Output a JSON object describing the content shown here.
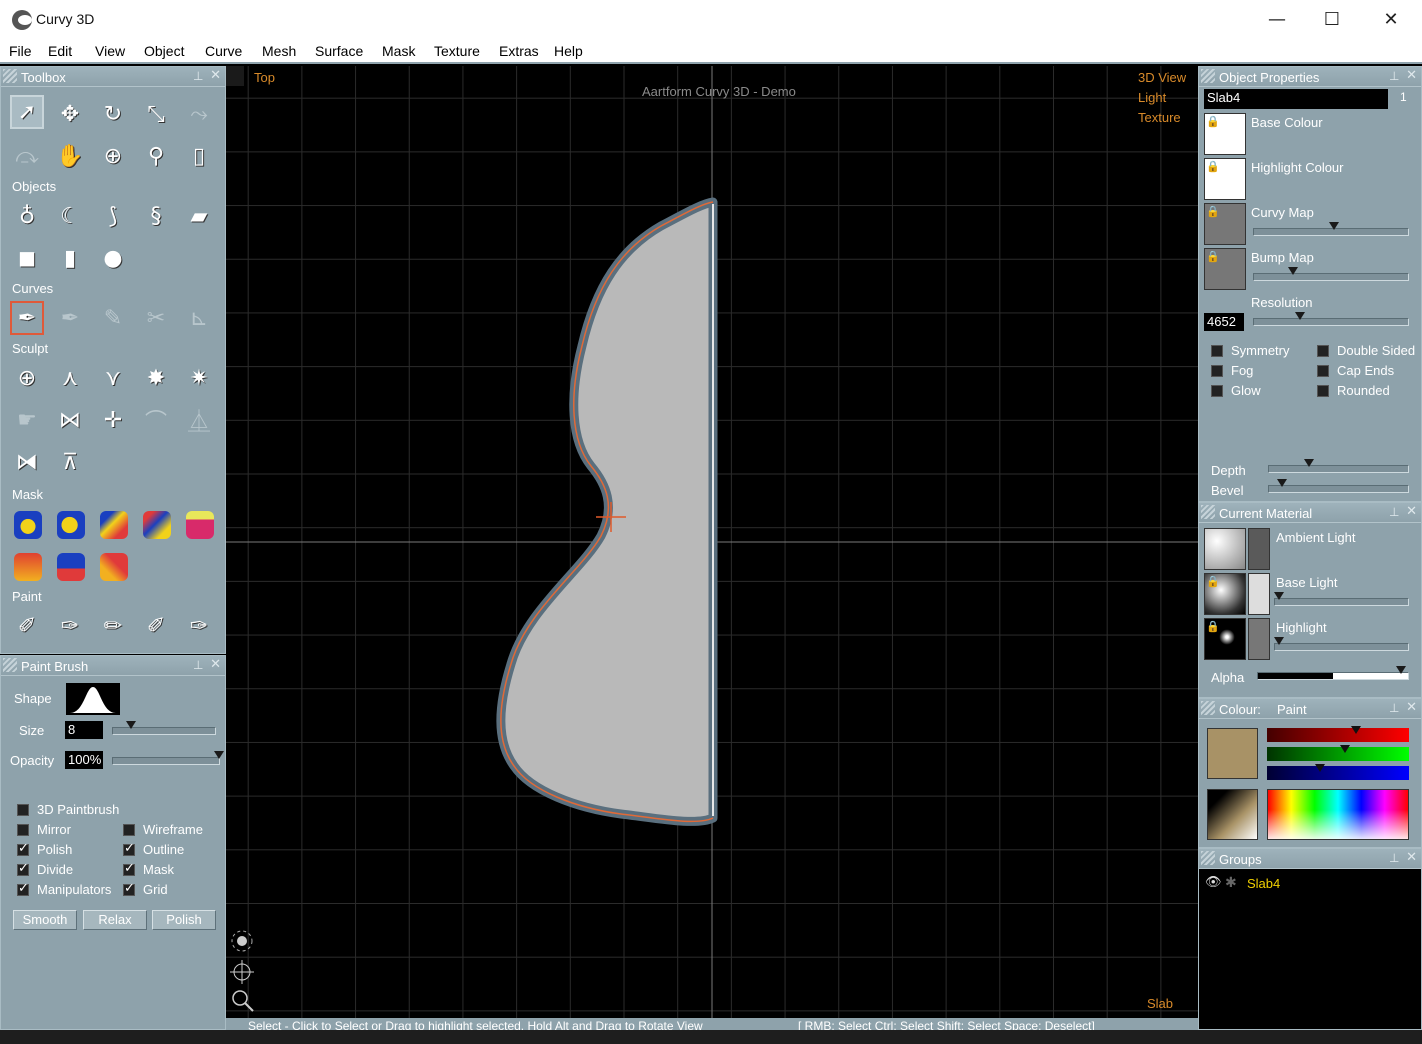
{
  "window": {
    "title": "Curvy 3D",
    "minimize": "—",
    "maximize": "☐",
    "close": "✕"
  },
  "menu": [
    "File",
    "Edit",
    "View",
    "Object",
    "Curve",
    "Mesh",
    "Surface",
    "Mask",
    "Texture",
    "Extras",
    "Help"
  ],
  "toolbox": {
    "title": "Toolbox",
    "sections": {
      "objects": "Objects",
      "curves": "Curves",
      "sculpt": "Sculpt",
      "mask": "Mask",
      "paint": "Paint"
    }
  },
  "paint_brush": {
    "title": "Paint Brush",
    "shape_label": "Shape",
    "size_label": "Size",
    "size_value": "8",
    "size_level": 0.18,
    "opacity_label": "Opacity",
    "opacity_value": "100%",
    "opacity_level": 1.0,
    "options": [
      {
        "label": "3D Paintbrush",
        "checked": false
      },
      {
        "label": "Mirror",
        "checked": false
      },
      {
        "label": "Wireframe",
        "checked": false
      },
      {
        "label": "Polish",
        "checked": true
      },
      {
        "label": "Outline",
        "checked": true
      },
      {
        "label": "Divide",
        "checked": true
      },
      {
        "label": "Mask",
        "checked": true
      },
      {
        "label": "Manipulators",
        "checked": true
      },
      {
        "label": "Grid",
        "checked": true
      }
    ],
    "buttons": [
      "Smooth",
      "Relax",
      "Polish"
    ]
  },
  "viewport": {
    "view_name": "Top",
    "watermark": "Aartform Curvy 3D - Demo",
    "modes": [
      "3D View",
      "Light",
      "Texture"
    ],
    "object_type": "Slab"
  },
  "object_properties": {
    "title": "Object Properties",
    "name": "Slab4",
    "index": "1",
    "base_colour": "Base Colour",
    "highlight_colour": "Highlight Colour",
    "curvy_map": "Curvy Map",
    "curvy_map_level": 0.52,
    "bump_map": "Bump Map",
    "bump_map_level": 0.25,
    "resolution_label": "Resolution",
    "resolution_value": "4652",
    "resolution_level": 0.3,
    "flags": [
      {
        "label": "Symmetry",
        "checked": false
      },
      {
        "label": "Double Sided",
        "checked": false
      },
      {
        "label": "Fog",
        "checked": false
      },
      {
        "label": "Cap Ends",
        "checked": false
      },
      {
        "label": "Glow",
        "checked": false
      },
      {
        "label": "Rounded",
        "checked": false
      }
    ],
    "depth_label": "Depth",
    "depth_level": 0.29,
    "bevel_label": "Bevel",
    "bevel_level": 0.09
  },
  "current_material": {
    "title": "Current Material",
    "ambient_light": "Ambient Light",
    "base_light": "Base Light",
    "base_light_level": 0.03,
    "highlight": "Highlight",
    "highlight_level": 0.03,
    "alpha_label": "Alpha",
    "alpha_level": 0.95
  },
  "colour": {
    "title": "Colour:",
    "mode": "Paint",
    "swatch": "#a89266",
    "red_level": 0.63,
    "green_level": 0.55,
    "blue_level": 0.37
  },
  "groups": {
    "title": "Groups",
    "items": [
      "Slab4"
    ]
  },
  "status": {
    "left": "Select - Click to Select or Drag to highlight selected. Hold Alt and Drag to Rotate View",
    "right": "[ RMB: Select   Ctrl: Select   Shift: Select   Space: Deselect]"
  }
}
